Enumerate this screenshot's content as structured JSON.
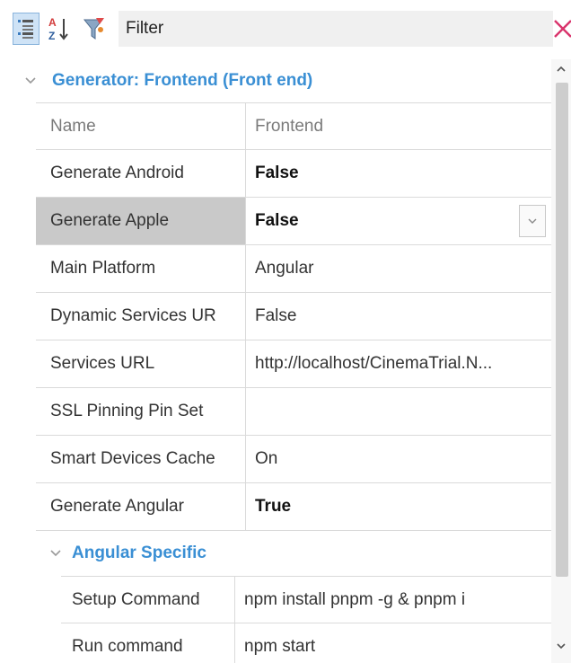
{
  "toolbar": {
    "filter_label": "Filter",
    "icons": [
      "categorized-icon",
      "alphabetical-sort-icon",
      "filter-icon",
      "clear-icon"
    ],
    "colors": {
      "accent": "#3a8fd4",
      "clear": "#d9336b"
    }
  },
  "group": {
    "title": "Generator: Frontend (Front end)",
    "rows": [
      {
        "name": "Name",
        "value": "Frontend"
      },
      {
        "name": "Generate Android",
        "value": "False"
      },
      {
        "name": "Generate Apple",
        "value": "False"
      },
      {
        "name": "Main Platform",
        "value": "Angular"
      },
      {
        "name": "Dynamic Services UR",
        "value": "False"
      },
      {
        "name": "Services URL",
        "value": "http://localhost/CinemaTrial.N..."
      },
      {
        "name": "SSL Pinning Pin Set",
        "value": ""
      },
      {
        "name": "Smart Devices Cache",
        "value": "On"
      },
      {
        "name": "Generate Angular",
        "value": "True"
      }
    ]
  },
  "subgroup": {
    "title": "Angular Specific",
    "rows": [
      {
        "name": "Setup Command",
        "value": "npm install pnpm -g & pnpm i"
      },
      {
        "name": "Run command",
        "value": "npm start"
      }
    ]
  }
}
